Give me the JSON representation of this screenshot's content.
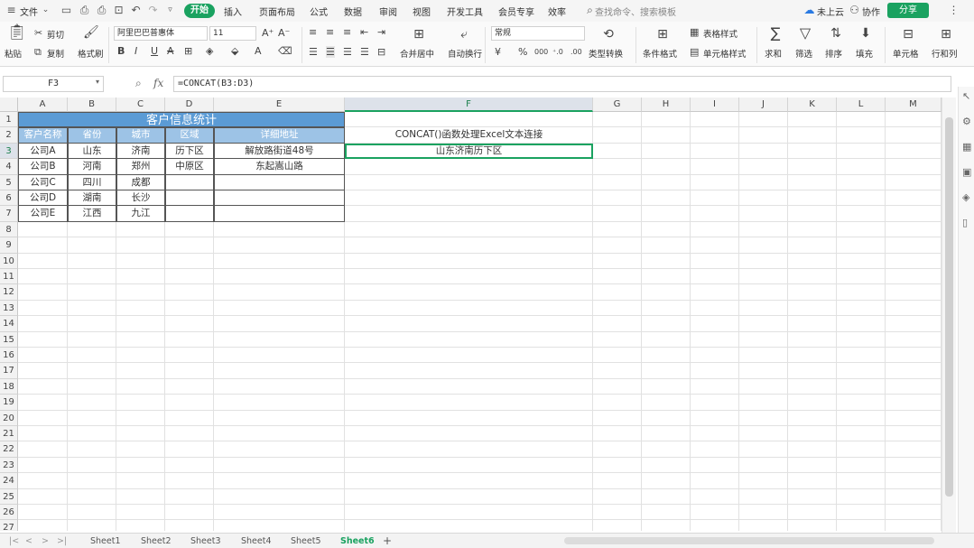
{
  "menu": {
    "file": "文件",
    "tabs": [
      "开始",
      "插入",
      "页面布局",
      "公式",
      "数据",
      "审阅",
      "视图",
      "开发工具",
      "会员专享",
      "效率"
    ],
    "search_placeholder": "查找命令、搜索模板",
    "cloud": "未上云",
    "collab": "协作",
    "share": "分享"
  },
  "ribbon": {
    "paste": "粘贴",
    "cut": "剪切",
    "copy": "复制",
    "format_painter": "格式刷",
    "font_name": "阿里巴巴普惠体",
    "font_size": "11",
    "merge_center": "合并居中",
    "wrap_text": "自动换行",
    "number_format": "常规",
    "type_convert": "类型转换",
    "cond_format": "条件格式",
    "table_style": "表格样式",
    "cell_style": "单元格样式",
    "sum": "求和",
    "filter": "筛选",
    "sort": "排序",
    "fill": "填充",
    "cells": "单元格",
    "rowcol": "行和列"
  },
  "formula_bar": {
    "name_box": "F3",
    "fx": "fx",
    "formula": "=CONCAT(B3:D3)"
  },
  "grid": {
    "columns": [
      "A",
      "B",
      "C",
      "D",
      "E",
      "F",
      "G",
      "H",
      "I",
      "J",
      "K",
      "L",
      "M"
    ],
    "rows": [
      "1",
      "2",
      "3",
      "4",
      "5",
      "6",
      "7",
      "8",
      "9",
      "10",
      "11",
      "12",
      "13",
      "14",
      "15",
      "16",
      "17",
      "18",
      "19",
      "20",
      "21",
      "22",
      "23",
      "24",
      "25",
      "26",
      "27"
    ],
    "title": "客户信息统计",
    "headers": [
      "客户名称",
      "省份",
      "城市",
      "区域",
      "详细地址"
    ],
    "data": [
      [
        "公司A",
        "山东",
        "济南",
        "历下区",
        "解放路街道48号"
      ],
      [
        "公司B",
        "河南",
        "郑州",
        "中原区",
        "东起嵩山路"
      ],
      [
        "公司C",
        "四川",
        "成都",
        "",
        ""
      ],
      [
        "公司D",
        "湖南",
        "长沙",
        "",
        ""
      ],
      [
        "公司E",
        "江西",
        "九江",
        "",
        ""
      ]
    ],
    "f2": "CONCAT()函数处理Excel文本连接",
    "f3": "山东济南历下区"
  },
  "sheets": [
    "Sheet1",
    "Sheet2",
    "Sheet3",
    "Sheet4",
    "Sheet5",
    "Sheet6"
  ],
  "colors": {
    "accent": "#1aa260",
    "title_fill": "#5b9bd5",
    "header_fill": "#9dc3e6"
  }
}
